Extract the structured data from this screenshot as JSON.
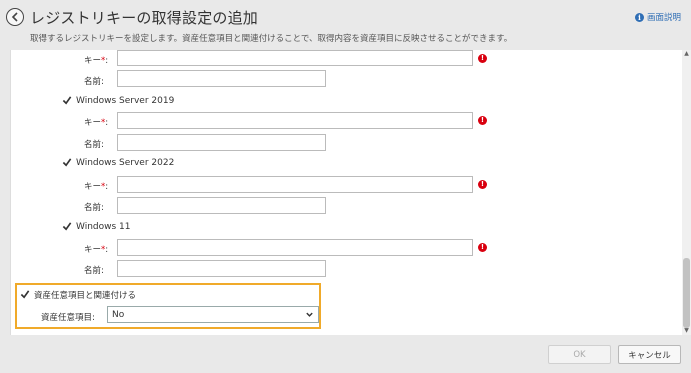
{
  "header": {
    "title": "レジストリキーの取得設定の追加",
    "subtitle": "取得するレジストリキーを設定します。資産任意項目と関連付けることで、取得内容を資産項目に反映させることができます。",
    "help_label": "画面説明",
    "help_icon": "info-icon",
    "back_icon": "back-arrow-icon"
  },
  "fields": {
    "key_label": "キー",
    "required_mark": "*",
    "colon": ":",
    "name_label": "名前:"
  },
  "os_items": [
    {
      "label": "Windows Server 2019",
      "checked": true
    },
    {
      "label": "Windows Server 2022",
      "checked": true
    },
    {
      "label": "Windows 11",
      "checked": true
    }
  ],
  "association": {
    "checkbox_label": "資産任意項目と関連付ける",
    "checked": true,
    "select_label": "資産任意項目:",
    "select_value": "No"
  },
  "footer": {
    "ok_label": "OK",
    "cancel_label": "キャンセル"
  },
  "colors": {
    "highlight": "#f0aa2a",
    "error": "#d9000f",
    "link": "#2f6eb5"
  }
}
